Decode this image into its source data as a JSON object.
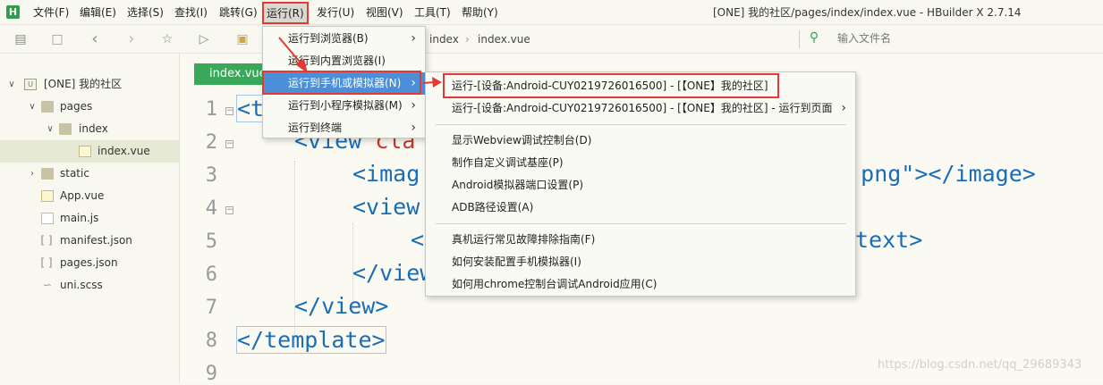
{
  "app": {
    "logo": "H",
    "window_title": "[ONE] 我的社区/pages/index/index.vue - HBuilder X 2.7.14"
  },
  "menubar": {
    "items": [
      "文件(F)",
      "编辑(E)",
      "选择(S)",
      "查找(I)",
      "跳转(G)",
      "运行(R)",
      "发行(U)",
      "视图(V)",
      "工具(T)",
      "帮助(Y)"
    ]
  },
  "toolbar": {
    "breadcrumb": [
      "index",
      "index.vue"
    ],
    "file_search_placeholder": "输入文件名"
  },
  "sidebar": {
    "items": [
      {
        "label": "[ONE] 我的社区"
      },
      {
        "label": "pages"
      },
      {
        "label": "index"
      },
      {
        "label": "index.vue"
      },
      {
        "label": "static"
      },
      {
        "label": "App.vue"
      },
      {
        "label": "main.js"
      },
      {
        "label": "manifest.json"
      },
      {
        "label": "pages.json"
      },
      {
        "label": "uni.scss"
      }
    ]
  },
  "editor": {
    "tab_label": "index.vue",
    "line_numbers": [
      "1",
      "2",
      "3",
      "4",
      "5",
      "6",
      "7",
      "8",
      "9"
    ],
    "lines": {
      "l1": "<t",
      "l2a": "<view ",
      "l2b": "cla",
      "l3a": "<imag",
      "l3b": "go.png\"></image>",
      "l4": "<view",
      "l5a": "<",
      "l5b": "text>",
      "l6": "</view",
      "l7": "</view>",
      "l8": "</template>"
    }
  },
  "run_menu": {
    "items": [
      {
        "label": "运行到浏览器(B)",
        "submenu": true
      },
      {
        "label": "运行到内置浏览器(I)",
        "submenu": false
      },
      {
        "label": "运行到手机或模拟器(N)",
        "submenu": true
      },
      {
        "label": "运行到小程序模拟器(M)",
        "submenu": true
      },
      {
        "label": "运行到终端",
        "submenu": true
      }
    ]
  },
  "device_submenu": {
    "items": [
      "运行-[设备:Android-CUY0219726016500] - [【ONE】我的社区]",
      "运行-[设备:Android-CUY0219726016500] - [【ONE】我的社区] - 运行到页面",
      "显示Webview调试控制台(D)",
      "制作自定义调试基座(P)",
      "Android模拟器端口设置(P)",
      "ADB路径设置(A)",
      "真机运行常见故障排除指南(F)",
      "如何安装配置手机模拟器(I)",
      "如何用chrome控制台调试Android应用(C)"
    ]
  },
  "watermark": "https://blog.csdn.net/qq_29689343",
  "colors": {
    "accent_green": "#39a85b",
    "menu_highlight": "#4a8fd7",
    "annotation_red": "#e53935"
  }
}
